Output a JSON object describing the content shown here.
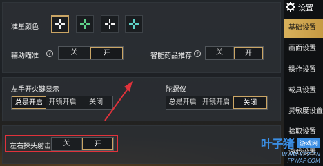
{
  "colors": {
    "accent": "#caa565",
    "highlight": "#e0323b",
    "sidebar_active": "#d8b15c"
  },
  "crosshair": {
    "label": "准星颜色",
    "options": [
      {
        "color": "#f2f2f2",
        "selected": true
      },
      {
        "color": "#5fd28a",
        "selected": false
      },
      {
        "color": "#f2f2f2",
        "selected": false
      },
      {
        "color": "#5fd2c8",
        "selected": false
      }
    ]
  },
  "aim_assist": {
    "label": "辅助瞄准",
    "help": "?",
    "options": [
      "关",
      "开"
    ],
    "selected": "开"
  },
  "smart_medicine": {
    "label": "智能药品推荐",
    "help": "?",
    "options": [
      "关",
      "开"
    ],
    "selected": "开"
  },
  "left_fire": {
    "label": "左手开火键显示",
    "options": [
      "总是开启",
      "开镜开启",
      "关闭"
    ],
    "selected": "总是开启"
  },
  "gyro": {
    "label": "陀螺仪",
    "options": [
      "总是开启",
      "开镜开启",
      "关闭"
    ],
    "selected": "关闭"
  },
  "peek_fire": {
    "label": "左右探头射击",
    "options": [
      "关",
      "开"
    ],
    "selected": "开"
  },
  "sidebar": {
    "title": "设置",
    "items": [
      "基础设置",
      "画面设置",
      "操作设置",
      "载具设置",
      "灵敏度设置",
      "拾取设置",
      "游戏设置"
    ],
    "active": "基础设置"
  },
  "watermark": {
    "logo": "叶子猪",
    "tag": "游戏网",
    "url": "WWW.YZZ.CN",
    "url2": "FPWAP.COM"
  }
}
